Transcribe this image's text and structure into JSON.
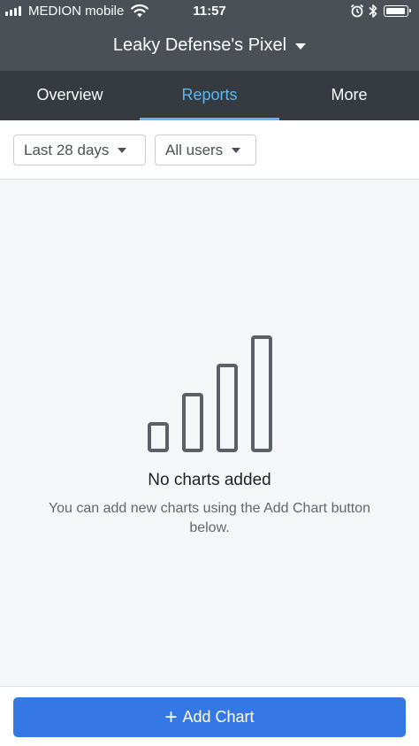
{
  "status_bar": {
    "carrier": "MEDION mobile",
    "time": "11:57",
    "icons": [
      "signal-icon",
      "wifi-icon",
      "alarm-icon",
      "bluetooth-icon",
      "battery-icon"
    ]
  },
  "header": {
    "account_name": "Leaky Defense's Pixel"
  },
  "tabs": [
    {
      "label": "Overview",
      "active": false
    },
    {
      "label": "Reports",
      "active": true
    },
    {
      "label": "More",
      "active": false
    }
  ],
  "filters": {
    "date_range": "Last 28 days",
    "audience": "All users"
  },
  "empty_state": {
    "icon": "bar-chart-icon",
    "title": "No charts added",
    "description": "You can add new charts using the Add Chart button below."
  },
  "actions": {
    "add_chart_label": "Add Chart"
  },
  "colors": {
    "header_bg": "#4b4f56",
    "tabs_bg": "#363a41",
    "active_tab": "#5cb6f0",
    "primary_button": "#3578e5",
    "background": "#f5f6f7"
  }
}
